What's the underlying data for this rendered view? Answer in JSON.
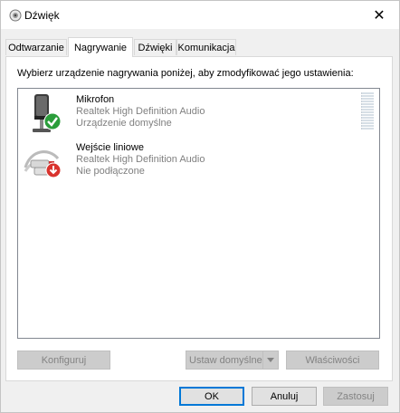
{
  "window": {
    "title": "Dźwięk",
    "close_glyph": "✕"
  },
  "tabs": [
    {
      "label": "Odtwarzanie",
      "active": false
    },
    {
      "label": "Nagrywanie",
      "active": true
    },
    {
      "label": "Dźwięki",
      "active": false
    },
    {
      "label": "Komunikacja",
      "active": false
    }
  ],
  "instruction": "Wybierz urządzenie nagrywania poniżej, aby zmodyfikować jego ustawienia:",
  "devices": [
    {
      "name": "Mikrofon",
      "driver": "Realtek High Definition Audio",
      "status": "Urządzenie domyślne",
      "icon": "microphone-icon",
      "badge": "check-icon"
    },
    {
      "name": "Wejście liniowe",
      "driver": "Realtek High Definition Audio",
      "status": "Nie podłączone",
      "icon": "line-in-cable-icon",
      "badge": "down-arrow-icon"
    }
  ],
  "buttons": {
    "configure": "Konfiguruj",
    "set_default": "Ustaw domyślne",
    "properties": "Właściwości",
    "ok": "OK",
    "cancel": "Anuluj",
    "apply": "Zastosuj"
  },
  "colors": {
    "accent": "#0078d7",
    "success": "#2a9d3a",
    "warning": "#d9332e",
    "disabled_text": "#838383"
  }
}
